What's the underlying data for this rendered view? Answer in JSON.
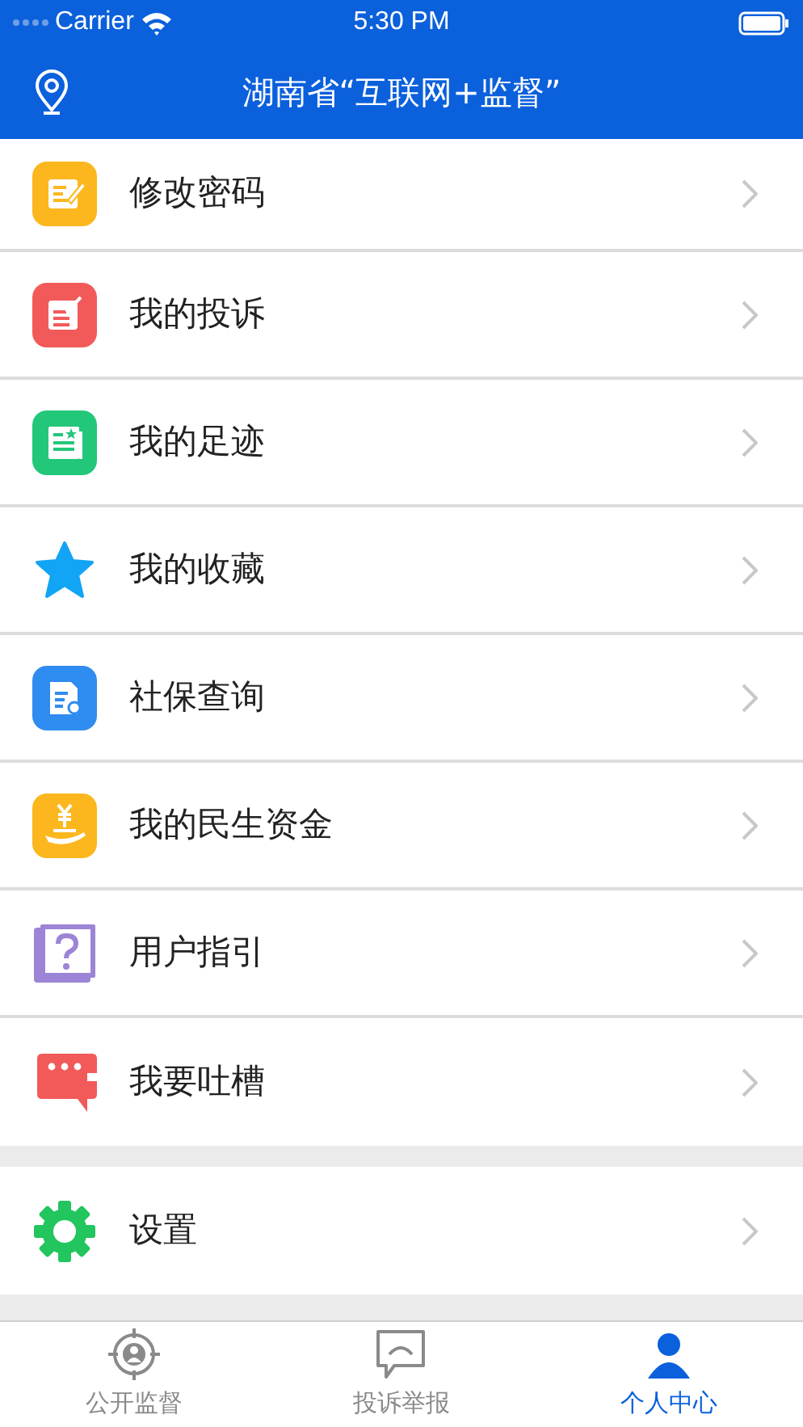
{
  "status_bar": {
    "carrier": "Carrier",
    "time": "5:30 PM"
  },
  "header": {
    "title": "湖南省“互联网+监督”"
  },
  "menu_groups": [
    {
      "items": [
        {
          "label": "修改密码"
        },
        {
          "label": "我的投诉"
        },
        {
          "label": "我的足迹"
        },
        {
          "label": "我的收藏"
        },
        {
          "label": "社保查询"
        },
        {
          "label": "我的民生资金"
        },
        {
          "label": "用户指引"
        },
        {
          "label": "我要吐槽"
        }
      ]
    },
    {
      "items": [
        {
          "label": "设置"
        }
      ]
    }
  ],
  "tab_bar": [
    {
      "label": "公开监督",
      "selected": false
    },
    {
      "label": "投诉举报",
      "selected": false
    },
    {
      "label": "个人中心",
      "selected": true
    }
  ]
}
